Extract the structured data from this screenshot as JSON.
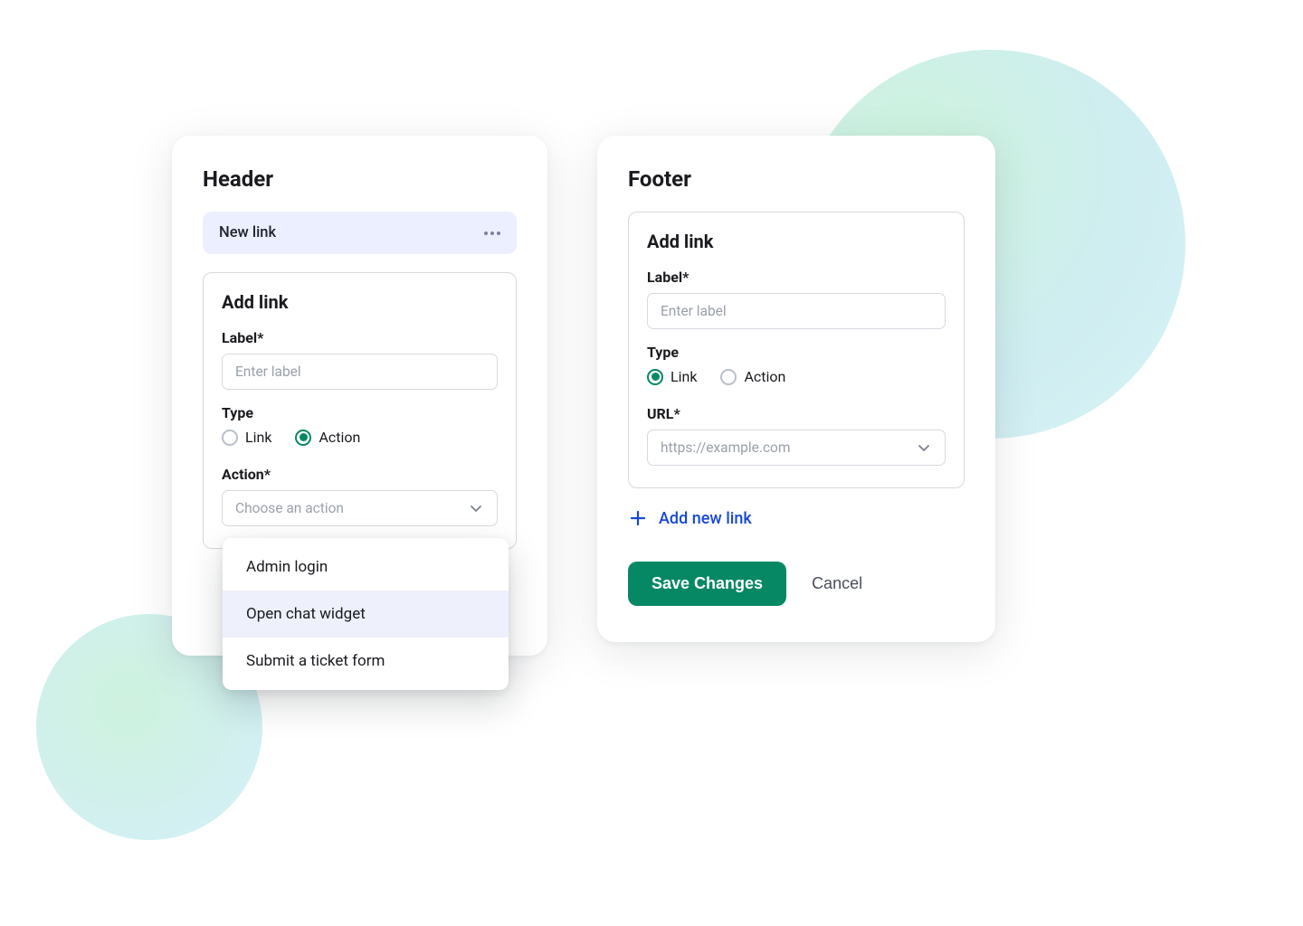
{
  "header": {
    "title": "Header",
    "new_link_pill": "New link",
    "form": {
      "title": "Add link",
      "label_field": "Label*",
      "label_placeholder": "Enter label",
      "type_field": "Type",
      "type_link": "Link",
      "type_action": "Action",
      "type_selected": "action",
      "action_field": "Action*",
      "action_placeholder": "Choose an action",
      "action_options": [
        "Admin login",
        "Open chat widget",
        "Submit a ticket form"
      ],
      "action_hover_index": 1
    }
  },
  "footer": {
    "title": "Footer",
    "form": {
      "title": "Add link",
      "label_field": "Label*",
      "label_placeholder": "Enter label",
      "type_field": "Type",
      "type_link": "Link",
      "type_action": "Action",
      "type_selected": "link",
      "url_field": "URL*",
      "url_placeholder": "https://example.com"
    },
    "add_new_link": "Add new link",
    "save_label": "Save Changes",
    "cancel_label": "Cancel"
  },
  "colors": {
    "accent_green": "#068864",
    "accent_blue": "#1849d6"
  }
}
